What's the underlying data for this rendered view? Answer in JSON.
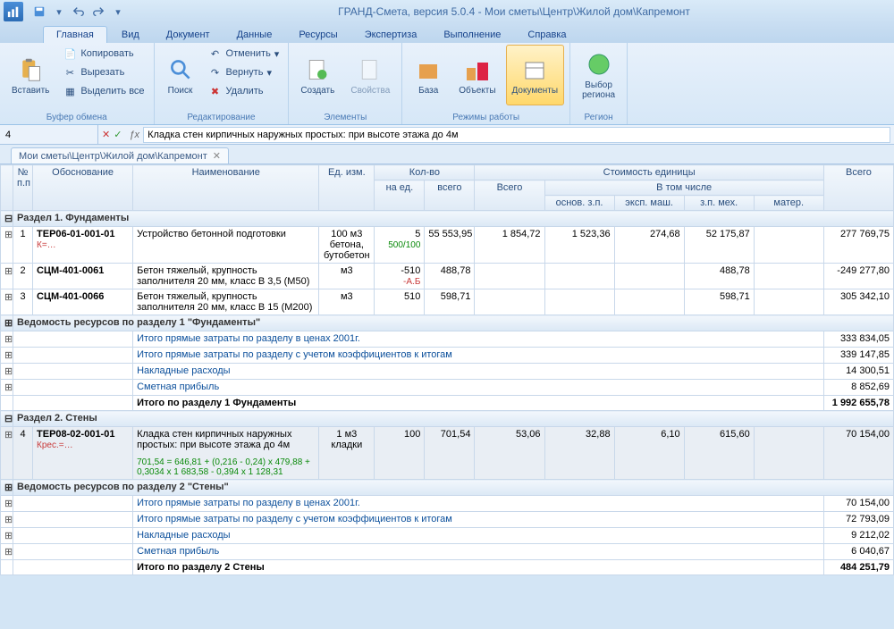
{
  "title": "ГРАНД-Смета, версия 5.0.4 - Мои сметы\\Центр\\Жилой дом\\Капремонт",
  "tabs": [
    "Главная",
    "Вид",
    "Документ",
    "Данные",
    "Ресурсы",
    "Экспертиза",
    "Выполнение",
    "Справка"
  ],
  "ribbon": {
    "clipboard": {
      "label": "Буфер обмена",
      "paste": "Вставить",
      "copy": "Копировать",
      "cut": "Вырезать",
      "select_all": "Выделить все"
    },
    "edit": {
      "label": "Редактирование",
      "search": "Поиск",
      "undo": "Отменить",
      "redo": "Вернуть",
      "delete": "Удалить"
    },
    "elements": {
      "label": "Элементы",
      "create": "Создать",
      "props": "Свойства"
    },
    "modes": {
      "label": "Режимы работы",
      "base": "База",
      "objects": "Объекты",
      "docs": "Документы"
    },
    "region": {
      "label": "Регион",
      "choose": "Выбор\nрегиона"
    }
  },
  "formula_bar": {
    "cell": "4",
    "text": "Кладка стен кирпичных наружных простых: при высоте этажа до 4м"
  },
  "doc_tab": "Мои сметы\\Центр\\Жилой дом\\Капремонт",
  "headers": {
    "num": "№\nп.п",
    "obn": "Обоснование",
    "name": "Наименование",
    "ed": "Ед. изм.",
    "qty": "Кол-во",
    "qty1": "на ед.",
    "qty2": "всего",
    "total": "Всего",
    "unit_cost": "Стоимость единицы",
    "incl": "В том числе",
    "c1": "основ. з.п.",
    "c2": "эксп. маш.",
    "c3": "з.п. мех.",
    "c4": "матер.",
    "rtotal": "Всего"
  },
  "sections": {
    "s1": "Раздел 1. Фундаменты",
    "r1": "Ведомость ресурсов по разделу 1 \"Фундаменты\"",
    "s2": "Раздел 2. Стены",
    "r2": "Ведомость ресурсов по разделу 2 \"Стены\""
  },
  "rows": [
    {
      "n": "1",
      "code": "ТЕР06-01-001-01",
      "sub": "К=…",
      "name": "Устройство бетонной подготовки",
      "ed": "100 м3 бетона, бутобетон",
      "q1": "5",
      "q1s": "500/100",
      "q2": "55 553,95",
      "c1": "1 854,72",
      "c2": "1 523,36",
      "c3": "274,68",
      "c4": "52 175,87",
      "tot": "277 769,75"
    },
    {
      "n": "2",
      "code": "СЦМ-401-0061",
      "name": "Бетон тяжелый, крупность заполнителя 20 мм, класс В 3,5 (М50)",
      "ed": "м3",
      "q1": "-510",
      "q1s": "-А.Б",
      "q2": "488,78",
      "c4": "488,78",
      "tot": "-249 277,80"
    },
    {
      "n": "3",
      "code": "СЦМ-401-0066",
      "name": "Бетон тяжелый, крупность заполнителя 20 мм, класс В 15 (М200)",
      "ed": "м3",
      "q1": "510",
      "q2": "598,71",
      "c4": "598,71",
      "tot": "305 342,10"
    }
  ],
  "subtotals1": [
    {
      "t": "Итого прямые затраты по разделу в ценах 2001г.",
      "v": "333 834,05"
    },
    {
      "t": "Итого прямые затраты по разделу с учетом коэффициентов к итогам",
      "v": "339 147,85"
    },
    {
      "t": "Накладные расходы",
      "v": "14 300,51"
    },
    {
      "t": "Сметная прибыль",
      "v": "8 852,69"
    },
    {
      "t": "Итого по разделу 1 Фундаменты",
      "v": "1 992 655,78",
      "bold": true
    }
  ],
  "row4": {
    "n": "4",
    "code": "ТЕР08-02-001-01",
    "sub": "Крес.=…",
    "name": "Кладка стен кирпичных наружных простых: при высоте этажа до 4м",
    "ed": "1 м3 кладки",
    "q1": "100",
    "q2": "701,54",
    "c1": "53,06",
    "c2": "32,88",
    "c3": "6,10",
    "c4": "615,60",
    "tot": "70 154,00",
    "formula": "701,54 = 646,81 + (0,216 - 0,24) x 479,88 + 0,3034 x 1 683,58 - 0,394 x 1 128,31"
  },
  "subtotals2": [
    {
      "t": "Итого прямые затраты по разделу в ценах 2001г.",
      "v": "70 154,00"
    },
    {
      "t": "Итого прямые затраты по разделу с учетом коэффициентов к итогам",
      "v": "72 793,09"
    },
    {
      "t": "Накладные расходы",
      "v": "9 212,02"
    },
    {
      "t": "Сметная прибыль",
      "v": "6 040,67"
    },
    {
      "t": "Итого по разделу 2 Стены",
      "v": "484 251,79",
      "bold": true
    }
  ]
}
